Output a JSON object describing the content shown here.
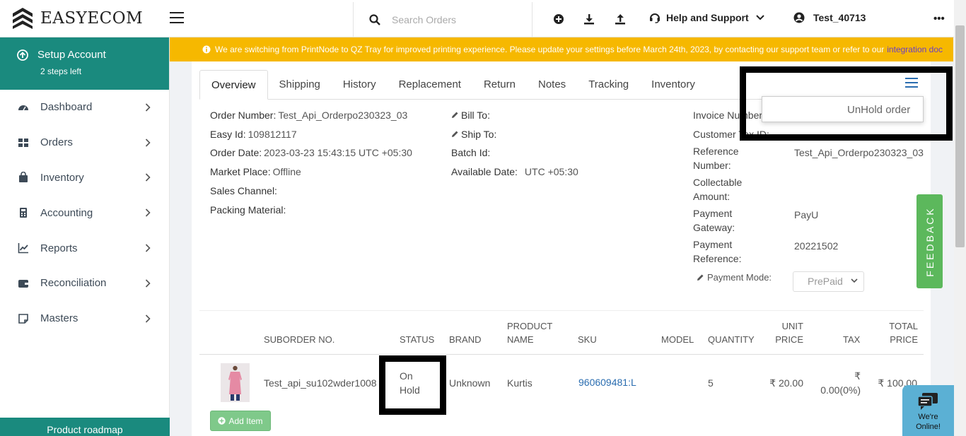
{
  "header": {
    "logo_text": "EASYECOM",
    "search_placeholder": "Search Orders",
    "help_label": "Help and Support",
    "user_name": "Test_40713",
    "more_label": "•••"
  },
  "sidebar": {
    "setup_title": "Setup Account",
    "setup_sub": "2 steps left",
    "items": [
      {
        "label": "Dashboard",
        "icon": "dashboard-icon"
      },
      {
        "label": "Orders",
        "icon": "grid-icon"
      },
      {
        "label": "Inventory",
        "icon": "bag-icon"
      },
      {
        "label": "Accounting",
        "icon": "calculator-icon"
      },
      {
        "label": "Reports",
        "icon": "chart-icon"
      },
      {
        "label": "Reconciliation",
        "icon": "wallet-icon"
      },
      {
        "label": "Masters",
        "icon": "note-icon"
      }
    ],
    "roadmap_label": "Product roadmap"
  },
  "banner": {
    "text": "We are switching from PrintNode to QZ Tray for improved printing experience. Please update your settings before March 24th, 2023, by contacting our support team or refer to our",
    "link_text": "integration doc",
    "color": "#f6b800"
  },
  "tabs": [
    "Overview",
    "Shipping",
    "History",
    "Replacement",
    "Return",
    "Notes",
    "Tracking",
    "Inventory"
  ],
  "order": {
    "order_number_label": "Order Number:",
    "order_number": "Test_Api_Orderpo230323_03",
    "easy_id_label": "Easy Id:",
    "easy_id": "109812117",
    "order_date_label": "Order Date:",
    "order_date": "2023-03-23 15:43:15 UTC +05:30",
    "market_place_label": "Market Place:",
    "market_place": "Offline",
    "sales_channel_label": "Sales Channel:",
    "packing_material_label": "Packing Material:",
    "bill_to_label": "Bill To:",
    "ship_to_label": "Ship To:",
    "batch_id_label": "Batch Id:",
    "available_date_label": "Available Date:",
    "available_date": "UTC +05:30",
    "invoice_number_label": "Invoice Number:",
    "customer_tax_label": "Customer Tax ID:",
    "reference_label_1": "Reference",
    "reference_label_2": "Number:",
    "reference_value": "Test_Api_Orderpo230323_03",
    "collectable_label_1": "Collectable",
    "collectable_label_2": "Amount:",
    "gateway_label_1": "Payment",
    "gateway_label_2": "Gateway:",
    "gateway_value": "PayU",
    "payref_label_1": "Payment",
    "payref_label_2": "Reference:",
    "payref_value": "20221502",
    "payment_mode_label": "Payment Mode:",
    "payment_mode_value": "PrePaid"
  },
  "actions": {
    "unhold_label": "UnHold order",
    "add_item_label": "Add Item"
  },
  "table": {
    "headers": {
      "suborder": "SUBORDER NO.",
      "status": "STATUS",
      "brand": "BRAND",
      "product_1": "PRODUCT",
      "product_2": "NAME",
      "sku": "SKU",
      "model": "MODEL",
      "quantity": "QUANTITY",
      "unit_1": "UNIT",
      "unit_2": "PRICE",
      "tax": "TAX",
      "total_1": "TOTAL",
      "total_2": "PRICE"
    },
    "rows": [
      {
        "suborder": "Test_api_su102wder1008",
        "status_1": "On",
        "status_2": "Hold",
        "brand": "Unknown",
        "product_name": "Kurtis",
        "sku": "960609481:L",
        "model": "",
        "quantity": "5",
        "unit_price": "₹ 20.00",
        "tax_1": "₹",
        "tax_2": "0.00(0%)",
        "total_price": "₹ 100.00"
      }
    ]
  },
  "feedback_label": "FEEDBACK",
  "chat": {
    "line1": "We're",
    "line2": "Online!"
  },
  "colors": {
    "brand_teal": "#1a8a7e",
    "banner_yellow": "#f6b800",
    "feedback_green": "#5cb85c",
    "link_blue": "#2a6db0"
  }
}
